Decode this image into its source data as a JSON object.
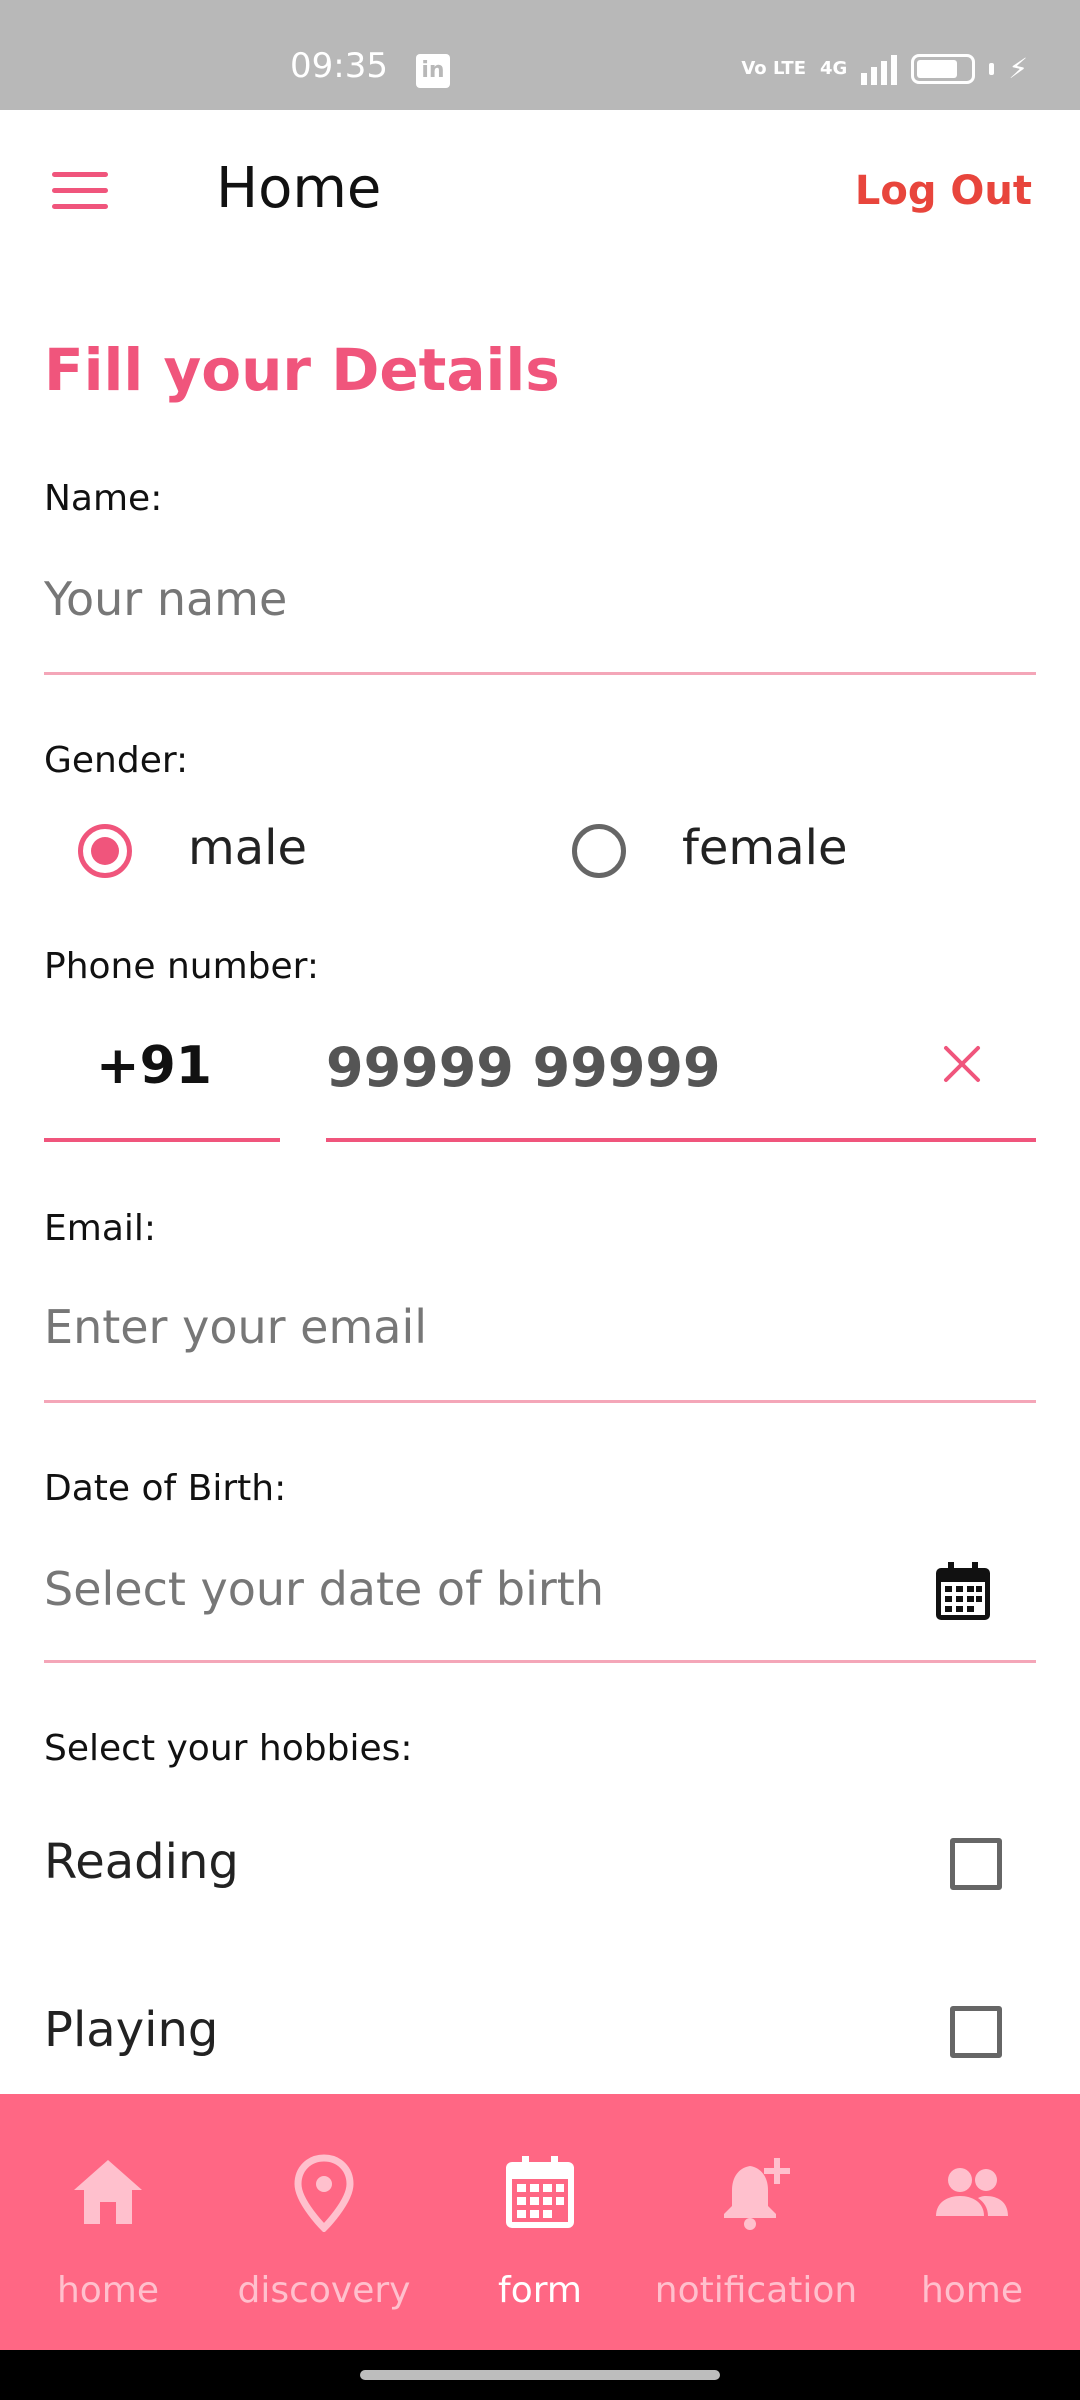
{
  "status_bar": {
    "time": "09:35",
    "network": "4G",
    "volte": "Vo LTE"
  },
  "app_bar": {
    "title": "Home",
    "logout_label": "Log Out"
  },
  "form": {
    "heading": "Fill your Details",
    "name": {
      "label": "Name:",
      "placeholder": "Your name"
    },
    "gender": {
      "label": "Gender:",
      "options": [
        "male",
        "female"
      ],
      "selected": "male"
    },
    "phone": {
      "label": "Phone number:",
      "country_code": "+91",
      "value": "99999 99999"
    },
    "email": {
      "label": "Email:",
      "placeholder": "Enter your email"
    },
    "dob": {
      "label": "Date of Birth:",
      "placeholder": "Select your date of birth"
    },
    "hobbies": {
      "label": "Select your hobbies:",
      "items": [
        {
          "label": "Reading",
          "checked": false
        },
        {
          "label": "Playing",
          "checked": false
        }
      ]
    }
  },
  "bottom_nav": {
    "items": [
      {
        "label": "home",
        "icon": "house-icon",
        "active": false
      },
      {
        "label": "discovery",
        "icon": "location-pin-icon",
        "active": false
      },
      {
        "label": "form",
        "icon": "calendar-icon",
        "active": true
      },
      {
        "label": "notification",
        "icon": "bell-add-icon",
        "active": false
      },
      {
        "label": "home",
        "icon": "people-icon",
        "active": false
      }
    ]
  },
  "colors": {
    "accent": "#f0557c",
    "logout": "#e8453c",
    "nav_bg": "#ff6784",
    "status_bar": "#b8b8b8"
  }
}
